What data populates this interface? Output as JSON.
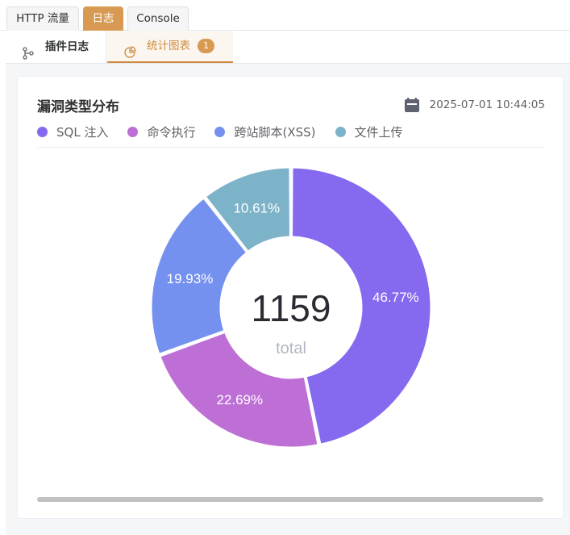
{
  "top_tabs": [
    {
      "label": "HTTP 流量",
      "active": false
    },
    {
      "label": "日志",
      "active": true
    },
    {
      "label": "Console",
      "active": false
    }
  ],
  "sub_tabs": [
    {
      "label": "插件日志",
      "icon": "git-branch-icon"
    },
    {
      "label": "统计图表",
      "icon": "pie-chart-icon",
      "badge": "1"
    }
  ],
  "card": {
    "title": "漏洞类型分布",
    "timestamp": "2025-07-01 10:44:05",
    "time_icon": "calendar-icon"
  },
  "colors": {
    "accent": "#d89a52",
    "sql": "#8569ef",
    "cmd": "#be6fd6",
    "xss": "#7591ef",
    "upload": "#7db3c9"
  },
  "chart_data": {
    "type": "pie",
    "donut": true,
    "center_value": "1159",
    "center_label": "total",
    "legend_placement": "top-left",
    "categories": [
      "SQL 注入",
      "命令执行",
      "跨站脚本(XSS)",
      "文件上传"
    ],
    "values": [
      46.77,
      22.69,
      19.93,
      10.61
    ],
    "value_labels": [
      "46.77%",
      "22.69%",
      "19.93%",
      "10.61%"
    ],
    "colors": [
      "#8569ef",
      "#be6fd6",
      "#7591ef",
      "#7db3c9"
    ]
  }
}
